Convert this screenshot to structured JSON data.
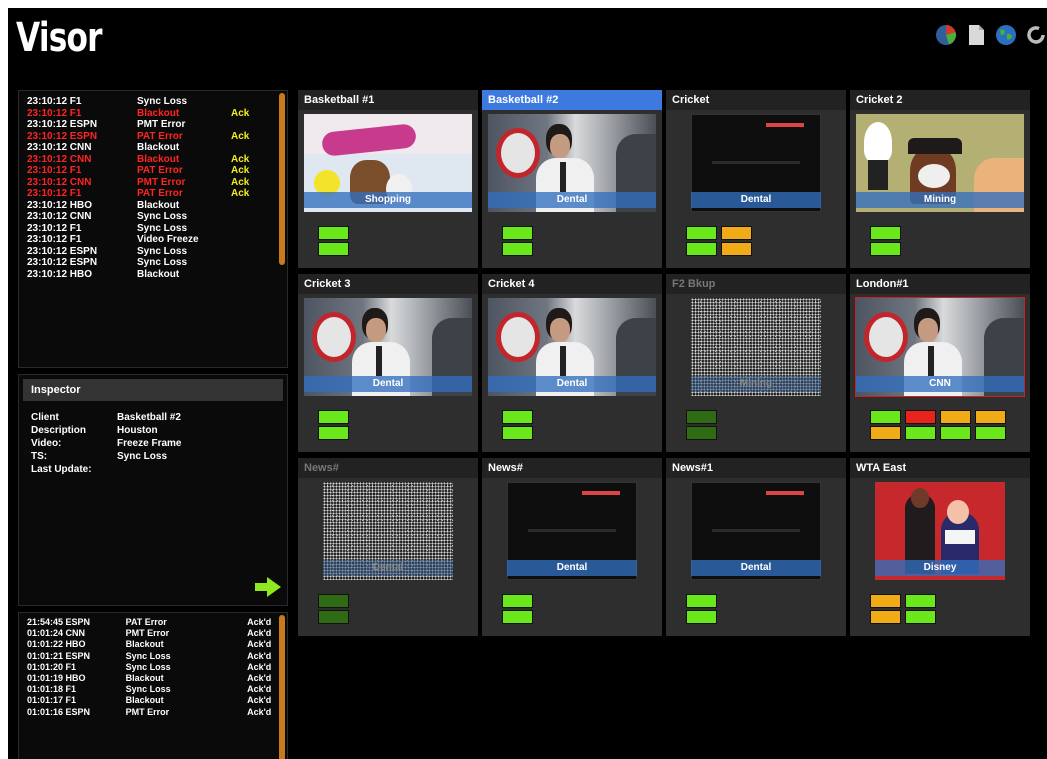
{
  "app": {
    "title": "Visor"
  },
  "toolbar": {
    "icons": [
      "pie-chart-icon",
      "document-icon",
      "globe-icon",
      "refresh-icon"
    ]
  },
  "alarms": [
    {
      "time": "23:10:12 F1",
      "msg": "Sync Loss",
      "ack": "",
      "alert": false
    },
    {
      "time": "23:10:12 F1",
      "msg": "Blackout",
      "ack": "Ack",
      "alert": true
    },
    {
      "time": "23:10:12 ESPN",
      "msg": "PMT Error",
      "ack": "",
      "alert": false
    },
    {
      "time": "23:10:12 ESPN",
      "msg": "PAT Error",
      "ack": "Ack",
      "alert": true
    },
    {
      "time": "23:10:12 CNN",
      "msg": "Blackout",
      "ack": "",
      "alert": false
    },
    {
      "time": "23:10:12 CNN",
      "msg": "Blackout",
      "ack": "Ack",
      "alert": true
    },
    {
      "time": "23:10:12 F1",
      "msg": "PAT Error",
      "ack": "Ack",
      "alert": true
    },
    {
      "time": "23:10:12 CNN",
      "msg": "PMT Error",
      "ack": "Ack",
      "alert": true
    },
    {
      "time": "23:10:12 F1",
      "msg": "PAT Error",
      "ack": "Ack",
      "alert": true
    },
    {
      "time": "23:10:12 HBO",
      "msg": "Blackout",
      "ack": "",
      "alert": false
    },
    {
      "time": "23:10:12 CNN",
      "msg": "Sync Loss",
      "ack": "",
      "alert": false
    },
    {
      "time": "23:10:12 F1",
      "msg": "Sync Loss",
      "ack": "",
      "alert": false
    },
    {
      "time": "23:10:12 F1",
      "msg": "Video Freeze",
      "ack": "",
      "alert": false
    },
    {
      "time": "23:10:12 ESPN",
      "msg": "Sync Loss",
      "ack": "",
      "alert": false
    },
    {
      "time": "23:10:12 ESPN",
      "msg": "Sync Loss",
      "ack": "",
      "alert": false
    },
    {
      "time": "23:10:12 HBO",
      "msg": "Blackout",
      "ack": "",
      "alert": false
    }
  ],
  "inspector": {
    "title": "Inspector",
    "rows": [
      {
        "k": "Client",
        "v": "Basketball #2"
      },
      {
        "k": "Description",
        "v": "Houston"
      },
      {
        "k": "Video:",
        "v": "Freeze Frame"
      },
      {
        "k": "TS:",
        "v": "Sync Loss"
      },
      {
        "k": "Last Update:",
        "v": ""
      }
    ]
  },
  "acked": [
    {
      "time": "21:54:45 ESPN",
      "msg": "PAT Error",
      "ack": "Ack'd"
    },
    {
      "time": "01:01:24 CNN",
      "msg": "PMT Error",
      "ack": "Ack'd"
    },
    {
      "time": "01:01:22 HBO",
      "msg": "Blackout",
      "ack": "Ack'd"
    },
    {
      "time": "01:01:21 ESPN",
      "msg": "Sync Loss",
      "ack": "Ack'd"
    },
    {
      "time": "01:01:20 F1",
      "msg": "Sync Loss",
      "ack": "Ack'd"
    },
    {
      "time": "01:01:19 HBO",
      "msg": "Blackout",
      "ack": "Ack'd"
    },
    {
      "time": "01:01:18 F1",
      "msg": "Sync Loss",
      "ack": "Ack'd"
    },
    {
      "time": "01:01:17 F1",
      "msg": "Blackout",
      "ack": "Ack'd"
    },
    {
      "time": "01:01:16 ESPN",
      "msg": "PMT Error",
      "ack": "Ack'd"
    }
  ],
  "tiles": [
    {
      "title": "Basketball #1",
      "label": "Shopping",
      "scene": "looney",
      "selected": false,
      "dim": false,
      "alarm": false,
      "status": [
        "green",
        "green"
      ]
    },
    {
      "title": "Basketball #2",
      "label": "Dental",
      "scene": "people",
      "selected": true,
      "dim": false,
      "alarm": false,
      "status": [
        "green",
        "green"
      ]
    },
    {
      "title": "Cricket",
      "label": "Dental",
      "scene": "blank",
      "selected": false,
      "dim": false,
      "alarm": false,
      "status": [
        "green",
        "amber",
        "green",
        "amber"
      ],
      "cols": 2
    },
    {
      "title": "Cricket 2",
      "label": "Mining",
      "scene": "cricket",
      "selected": false,
      "dim": false,
      "alarm": false,
      "status": [
        "green",
        "green"
      ]
    },
    {
      "title": "Cricket 3",
      "label": "Dental",
      "scene": "people",
      "selected": false,
      "dim": false,
      "alarm": false,
      "status": [
        "green",
        "green"
      ]
    },
    {
      "title": "Cricket 4",
      "label": "Dental",
      "scene": "people",
      "selected": false,
      "dim": false,
      "alarm": false,
      "status": [
        "green",
        "green"
      ]
    },
    {
      "title": "F2 Bkup",
      "label": "Mining",
      "scene": "static",
      "selected": false,
      "dim": true,
      "alarm": false,
      "status": [
        "dim-green",
        "dim-green"
      ]
    },
    {
      "title": "London#1",
      "label": "CNN",
      "scene": "people",
      "selected": false,
      "dim": false,
      "alarm": true,
      "status": [
        "green",
        "red",
        "amber",
        "amber",
        "amber",
        "green",
        "green",
        "green"
      ],
      "cols": 4
    },
    {
      "title": "News#",
      "label": "Dental",
      "scene": "static",
      "selected": false,
      "dim": true,
      "alarm": false,
      "status": [
        "dim-green",
        "dim-green"
      ]
    },
    {
      "title": "News#",
      "label": "Dental",
      "scene": "blank",
      "selected": false,
      "dim": false,
      "alarm": false,
      "status": [
        "green",
        "green"
      ]
    },
    {
      "title": "News#1",
      "label": "Dental",
      "scene": "blank",
      "selected": false,
      "dim": false,
      "alarm": false,
      "status": [
        "green",
        "green"
      ]
    },
    {
      "title": "WTA East",
      "label": "Disney",
      "scene": "wta",
      "selected": false,
      "dim": false,
      "alarm": false,
      "status": [
        "amber",
        "green",
        "amber",
        "green"
      ],
      "cols": 2
    }
  ],
  "colors": {
    "green": "#6ae81c",
    "amber": "#f0ab16",
    "red": "#e8231c",
    "selected": "#3d7ae0",
    "alert_text": "#ff2424",
    "ack_text": "#f2ee1c",
    "scrollbar": "#c87a1a"
  }
}
